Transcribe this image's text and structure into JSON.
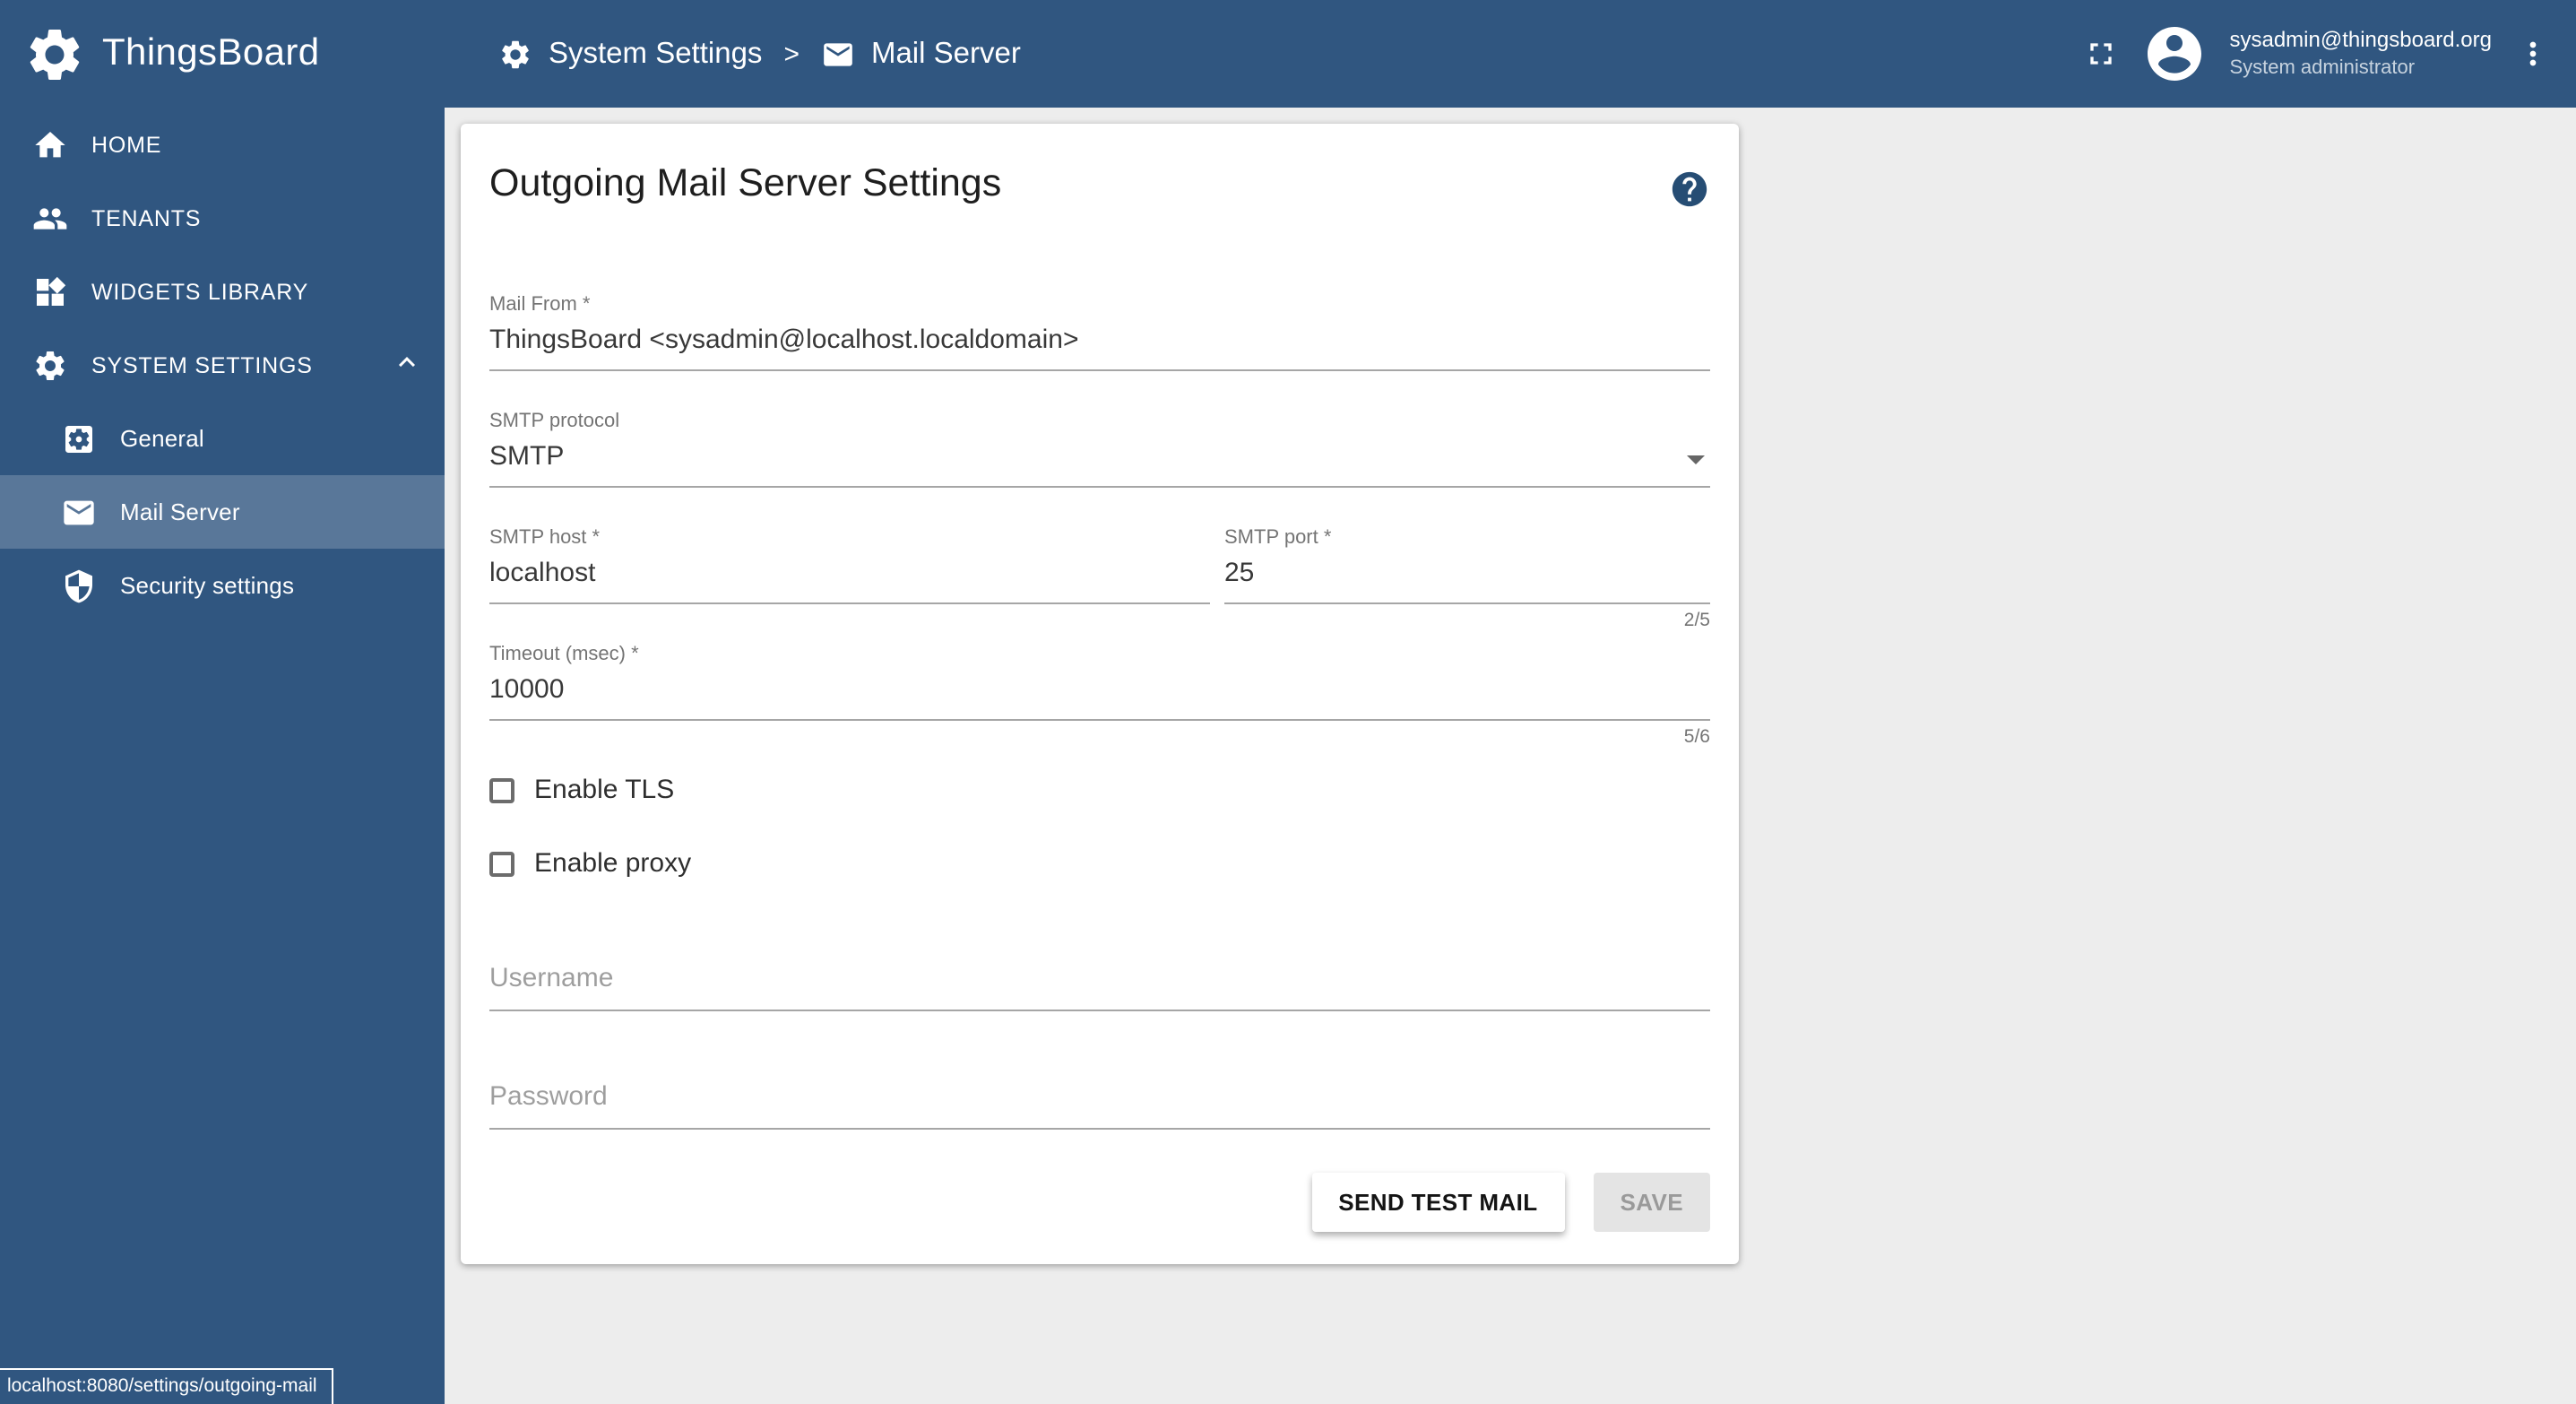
{
  "header": {
    "logo_text": "ThingsBoard",
    "breadcrumb": {
      "section": "System Settings",
      "separator": ">",
      "page": "Mail Server"
    },
    "user": {
      "email": "sysadmin@thingsboard.org",
      "role": "System administrator"
    }
  },
  "sidebar": {
    "items": [
      {
        "label": "HOME",
        "icon": "home-icon"
      },
      {
        "label": "TENANTS",
        "icon": "tenants-icon"
      },
      {
        "label": "WIDGETS LIBRARY",
        "icon": "widgets-icon"
      },
      {
        "label": "SYSTEM SETTINGS",
        "icon": "gear-icon",
        "expanded": true
      }
    ],
    "subitems": [
      {
        "label": "General",
        "icon": "general-settings-icon",
        "selected": false
      },
      {
        "label": "Mail Server",
        "icon": "mail-icon",
        "selected": true
      },
      {
        "label": "Security settings",
        "icon": "shield-icon",
        "selected": false
      }
    ]
  },
  "card": {
    "title": "Outgoing Mail Server Settings",
    "fields": {
      "mail_from": {
        "label": "Mail From *",
        "value": "ThingsBoard <sysadmin@localhost.localdomain>"
      },
      "smtp_protocol": {
        "label": "SMTP protocol",
        "value": "SMTP"
      },
      "smtp_host": {
        "label": "SMTP host *",
        "value": "localhost"
      },
      "smtp_port": {
        "label": "SMTP port *",
        "value": "25",
        "counter": "2/5"
      },
      "timeout": {
        "label": "Timeout (msec) *",
        "value": "10000",
        "counter": "5/6"
      },
      "enable_tls": {
        "label": "Enable TLS",
        "checked": false
      },
      "enable_proxy": {
        "label": "Enable proxy",
        "checked": false
      },
      "username": {
        "placeholder": "Username",
        "value": ""
      },
      "password": {
        "placeholder": "Password",
        "value": ""
      }
    },
    "buttons": {
      "send_test_mail": "SEND TEST MAIL",
      "save": "SAVE"
    }
  },
  "statusbar": {
    "url": "localhost:8080/settings/outgoing-mail"
  },
  "colors": {
    "primary": "#305680",
    "sidebar_selected": "rgba(255,255,255,0.2)",
    "content_background": "#ededed",
    "help_icon": "#264d74"
  }
}
